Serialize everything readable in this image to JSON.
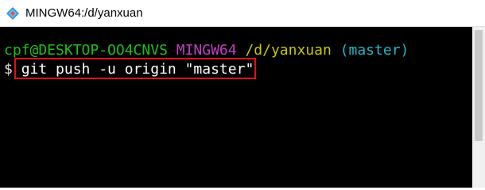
{
  "window": {
    "title": "MINGW64:/d/yanxuan"
  },
  "terminal": {
    "prompt_user": "cpf@DESKTOP-OO4CNVS",
    "prompt_system": "MINGW64",
    "prompt_path": "/d/yanxuan",
    "prompt_branch": "(master)",
    "prompt_symbol": "$",
    "command": "git push -u origin \"master\""
  },
  "colors": {
    "background": "#000000",
    "user": "#1cc01c",
    "system": "#c040c0",
    "path": "#c8c800",
    "branch": "#20b8c8",
    "highlight": "#e0101a"
  },
  "icons": {
    "app": "git-bash-icon"
  }
}
